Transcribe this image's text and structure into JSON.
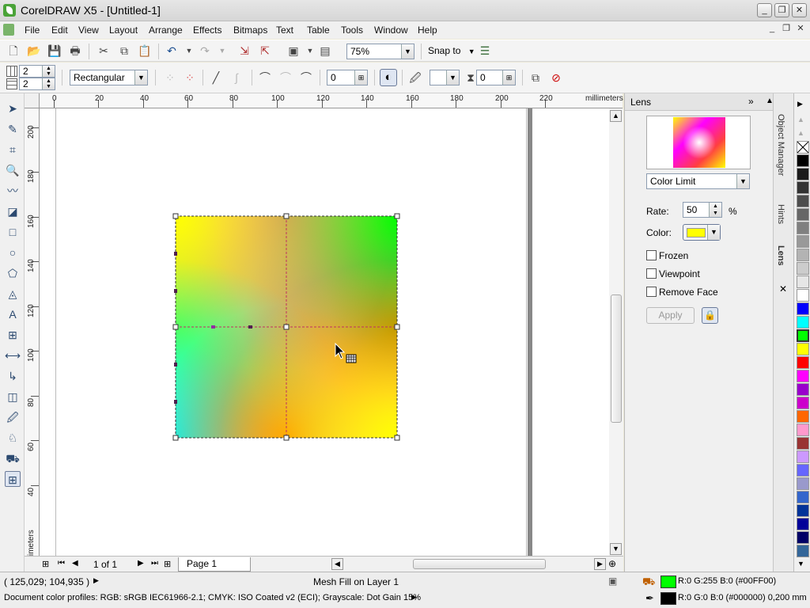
{
  "window": {
    "title": "CorelDRAW X5 - [Untitled-1]"
  },
  "menu": [
    "File",
    "Edit",
    "View",
    "Layout",
    "Arrange",
    "Effects",
    "Bitmaps",
    "Text",
    "Table",
    "Tools",
    "Window",
    "Help"
  ],
  "toolbar": {
    "zoom": "75%",
    "snap_to": "Snap to"
  },
  "propbar": {
    "grid_cols": "2",
    "grid_rows": "2",
    "mesh_type": "Rectangular",
    "curve_smoothness": "0",
    "transparency_value": "0",
    "transparency_sample": "0"
  },
  "rulers": {
    "unit": "millimeters",
    "h_labels": [
      "0",
      "20",
      "40",
      "60",
      "80",
      "100",
      "120",
      "140",
      "160",
      "180",
      "200",
      "220"
    ],
    "v_labels": [
      "200",
      "180",
      "160",
      "140",
      "120",
      "100",
      "80",
      "60",
      "40"
    ]
  },
  "docker": {
    "title": "Lens",
    "lens_type": "Color Limit",
    "rate_label": "Rate:",
    "rate_value": "50",
    "rate_unit": "%",
    "color_label": "Color:",
    "frozen": "Frozen",
    "viewpoint": "Viewpoint",
    "remove_face": "Remove Face",
    "apply": "Apply",
    "lens_color": "#ffff00"
  },
  "docker_tabs": [
    "Object Manager",
    "Hints",
    "Lens"
  ],
  "page_nav": {
    "page_count": "1 of 1",
    "page_tab": "Page 1"
  },
  "status": {
    "coords": "( 125,029; 104,935 )",
    "object_info": "Mesh Fill on Layer 1",
    "color_profiles": "Document color profiles: RGB: sRGB IEC61966-2.1; CMYK: ISO Coated v2 (ECI); Grayscale: Dot Gain 15%",
    "fill_info": "R:0 G:255 B:0 (#00FF00)",
    "outline_info": "R:0 G:0 B:0 (#000000)  0,200 mm",
    "fill_color": "#00ff00",
    "outline_color": "#000000"
  },
  "palette": [
    "#000000",
    "#1a1a1a",
    "#333333",
    "#4d4d4d",
    "#666666",
    "#808080",
    "#999999",
    "#b3b3b3",
    "#cccccc",
    "#e6e6e6",
    "#ffffff",
    "#0000ff",
    "#00ffff",
    "#00ff00",
    "#ffff00",
    "#ff0000",
    "#ff00ff",
    "#9900cc",
    "#cc00cc",
    "#ff6600",
    "#ff99cc",
    "#993333",
    "#cc99ff",
    "#6666ff",
    "#9999cc",
    "#3366cc",
    "#003399",
    "#000099",
    "#000066",
    "#336699"
  ]
}
